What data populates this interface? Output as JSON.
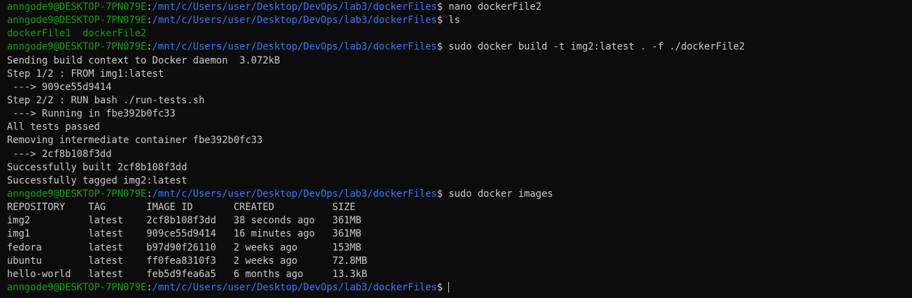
{
  "terminal": {
    "prompt_user": "anngode9@DESKTOP-7PN079E",
    "prompt_sep": ":",
    "prompt_path": "/mnt/c/Users/user/Desktop/DevOps/lab3/dockerFiles",
    "prompt_symbol": "$",
    "colors": {
      "background": "#0c0c0c",
      "foreground": "#cccccc",
      "user": "#13a10e",
      "path": "#3b78ff"
    },
    "lines": [
      {
        "type": "prompt",
        "command": " nano dockerFile2"
      },
      {
        "type": "prompt",
        "command": " ls"
      },
      {
        "type": "green",
        "text": "dockerFile1  dockerFile2"
      },
      {
        "type": "prompt",
        "command": " sudo docker build -t img2:latest . -f ./dockerFile2"
      },
      {
        "type": "output",
        "text": "Sending build context to Docker daemon  3.072kB"
      },
      {
        "type": "output",
        "text": "Step 1/2 : FROM img1:latest"
      },
      {
        "type": "output",
        "text": " ---> 909ce55d9414"
      },
      {
        "type": "output",
        "text": "Step 2/2 : RUN bash ./run-tests.sh"
      },
      {
        "type": "output",
        "text": " ---> Running in fbe392b0fc33"
      },
      {
        "type": "output",
        "text": "All tests passed"
      },
      {
        "type": "output",
        "text": "Removing intermediate container fbe392b0fc33"
      },
      {
        "type": "output",
        "text": " ---> 2cf8b108f3dd"
      },
      {
        "type": "output",
        "text": "Successfully built 2cf8b108f3dd"
      },
      {
        "type": "output",
        "text": "Successfully tagged img2:latest"
      },
      {
        "type": "prompt",
        "command": " sudo docker images"
      },
      {
        "type": "output",
        "text": "REPOSITORY    TAG       IMAGE ID       CREATED          SIZE"
      },
      {
        "type": "output",
        "text": "img2          latest    2cf8b108f3dd   38 seconds ago   361MB"
      },
      {
        "type": "output",
        "text": "img1          latest    909ce55d9414   16 minutes ago   361MB"
      },
      {
        "type": "output",
        "text": "fedora        latest    b97d90f26110   2 weeks ago      153MB"
      },
      {
        "type": "output",
        "text": "ubuntu        latest    ff0fea8310f3   2 weeks ago      72.8MB"
      },
      {
        "type": "output",
        "text": "hello-world   latest    feb5d9fea6a5   6 months ago     13.3kB"
      },
      {
        "type": "prompt",
        "command": "",
        "cursor": true
      }
    ]
  }
}
